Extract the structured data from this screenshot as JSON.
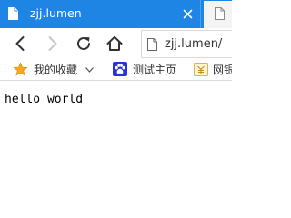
{
  "browser": {
    "active_tab": {
      "title": "zjj.lumen",
      "favicon": "page-icon",
      "close_icon": "close-icon"
    },
    "inactive_tab": {
      "favicon": "page-icon"
    },
    "toolbar": {
      "back_icon": "back-arrow-icon",
      "forward_icon": "forward-arrow-icon",
      "reload_icon": "reload-icon",
      "home_icon": "home-icon",
      "url": "zjj.lumen/"
    },
    "bookmarks": [
      {
        "label": "我的收藏",
        "icon": "star-icon",
        "has_dropdown": true
      },
      {
        "label": "测试主页",
        "icon": "paw-icon"
      },
      {
        "label": "网银",
        "icon": "folder-icon"
      }
    ]
  },
  "page": {
    "text": "hello world"
  },
  "colors": {
    "tab_bar": "#1e85e4",
    "star": "#f5a623",
    "paw": "#2932e1"
  }
}
